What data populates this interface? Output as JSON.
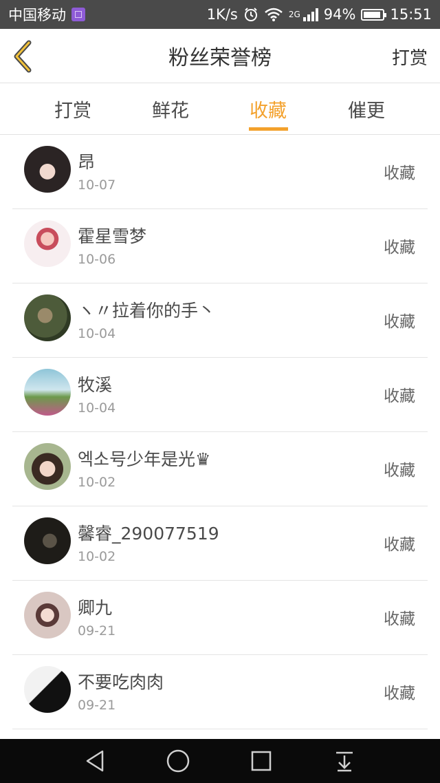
{
  "status_bar": {
    "carrier": "中国移动",
    "speed": "1K/s",
    "network": "2G",
    "battery": "94%",
    "battery_level": 0.94,
    "time": "15:51",
    "icons": [
      "sim-icon",
      "alarm-icon",
      "wifi-icon",
      "signal-icon",
      "battery-icon"
    ]
  },
  "header": {
    "title": "粉丝荣誉榜",
    "action_label": "打赏",
    "back_icon": "chevron-left-icon",
    "accent_color": "#f3a12c"
  },
  "tabs": [
    {
      "label": "打赏",
      "active": false
    },
    {
      "label": "鲜花",
      "active": false
    },
    {
      "label": "收藏",
      "active": true
    },
    {
      "label": "催更",
      "active": false
    }
  ],
  "fans": [
    {
      "name": "昂",
      "date": "10-07",
      "action": "收藏"
    },
    {
      "name": "霍星雪梦",
      "date": "10-06",
      "action": "收藏"
    },
    {
      "name": "ヽ〃拉着你的手丶",
      "date": "10-04",
      "action": "收藏"
    },
    {
      "name": "牧溪",
      "date": "10-04",
      "action": "收藏"
    },
    {
      "name": "엑소号少年是光♛",
      "date": "10-02",
      "action": "收藏"
    },
    {
      "name": "馨睿_290077519",
      "date": "10-02",
      "action": "收藏"
    },
    {
      "name": "卿九",
      "date": "09-21",
      "action": "收藏"
    },
    {
      "name": "不要吃肉肉",
      "date": "09-21",
      "action": "收藏"
    }
  ],
  "nav_bar": {
    "icons": [
      "back-triangle-icon",
      "home-circle-icon",
      "recents-square-icon",
      "notification-pull-icon"
    ]
  }
}
